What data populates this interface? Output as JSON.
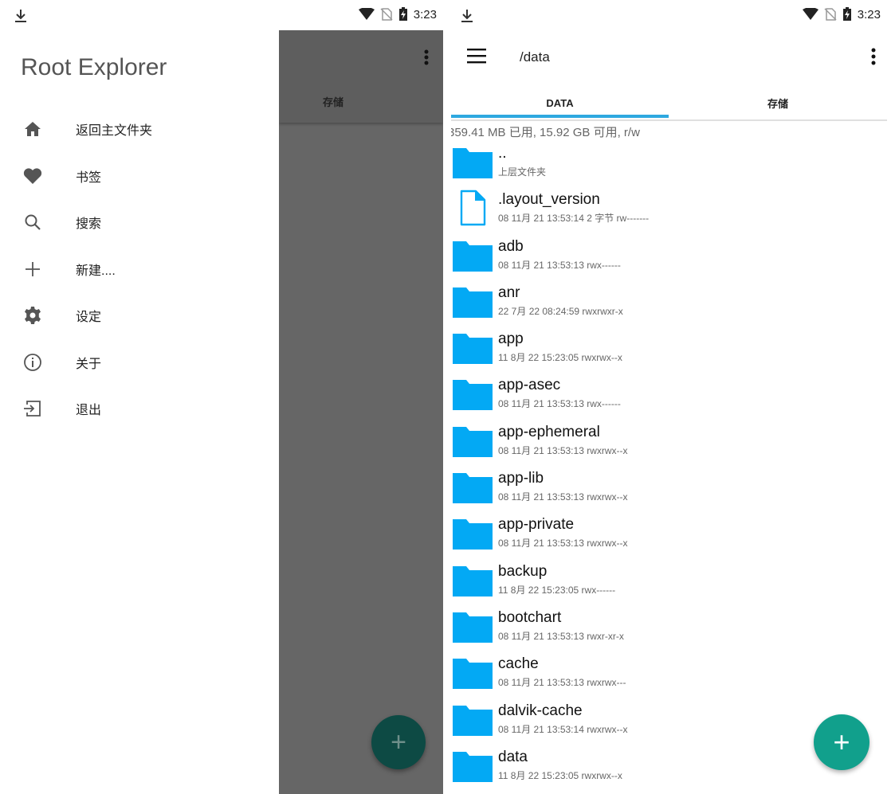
{
  "status": {
    "time": "3:23"
  },
  "left": {
    "drawer": {
      "title": "Root Explorer",
      "items": [
        {
          "icon": "home-icon",
          "label": "返回主文件夹"
        },
        {
          "icon": "heart-icon",
          "label": "书签"
        },
        {
          "icon": "search-icon",
          "label": "搜索"
        },
        {
          "icon": "plus-icon",
          "label": "新建...."
        },
        {
          "icon": "gear-icon",
          "label": "设定"
        },
        {
          "icon": "info-icon",
          "label": "关于"
        },
        {
          "icon": "exit-icon",
          "label": "退出"
        }
      ]
    },
    "background_tab": "存储",
    "fab": "+"
  },
  "right": {
    "path": "/data",
    "tabs": [
      "DATA",
      "存储"
    ],
    "storage_info": "359.41 MB 已用, 15.92 GB 可用, r/w",
    "files": [
      {
        "type": "folder",
        "name": "..",
        "meta": "上层文件夹"
      },
      {
        "type": "file",
        "name": ".layout_version",
        "meta": "08 11月 21 13:53:14  2 字节  rw-------"
      },
      {
        "type": "folder",
        "name": "adb",
        "meta": "08 11月 21 13:53:13    rwx------"
      },
      {
        "type": "folder",
        "name": "anr",
        "meta": "22 7月 22 08:24:59    rwxrwxr-x"
      },
      {
        "type": "folder",
        "name": "app",
        "meta": "11 8月 22 15:23:05    rwxrwx--x"
      },
      {
        "type": "folder",
        "name": "app-asec",
        "meta": "08 11月 21 13:53:13    rwx------"
      },
      {
        "type": "folder",
        "name": "app-ephemeral",
        "meta": "08 11月 21 13:53:13    rwxrwx--x"
      },
      {
        "type": "folder",
        "name": "app-lib",
        "meta": "08 11月 21 13:53:13    rwxrwx--x"
      },
      {
        "type": "folder",
        "name": "app-private",
        "meta": "08 11月 21 13:53:13    rwxrwx--x"
      },
      {
        "type": "folder",
        "name": "backup",
        "meta": "11 8月 22 15:23:05    rwx------"
      },
      {
        "type": "folder",
        "name": "bootchart",
        "meta": "08 11月 21 13:53:13    rwxr-xr-x"
      },
      {
        "type": "folder",
        "name": "cache",
        "meta": "08 11月 21 13:53:13    rwxrwx---"
      },
      {
        "type": "folder",
        "name": "dalvik-cache",
        "meta": "08 11月 21 13:53:14    rwxrwx--x"
      },
      {
        "type": "folder",
        "name": "data",
        "meta": "11 8月 22 15:23:05    rwxrwx--x"
      }
    ],
    "fab": "+"
  },
  "colors": {
    "accent": "#11a08c",
    "folder": "#03a9f4",
    "tab_indicator": "#2ea8e0"
  }
}
